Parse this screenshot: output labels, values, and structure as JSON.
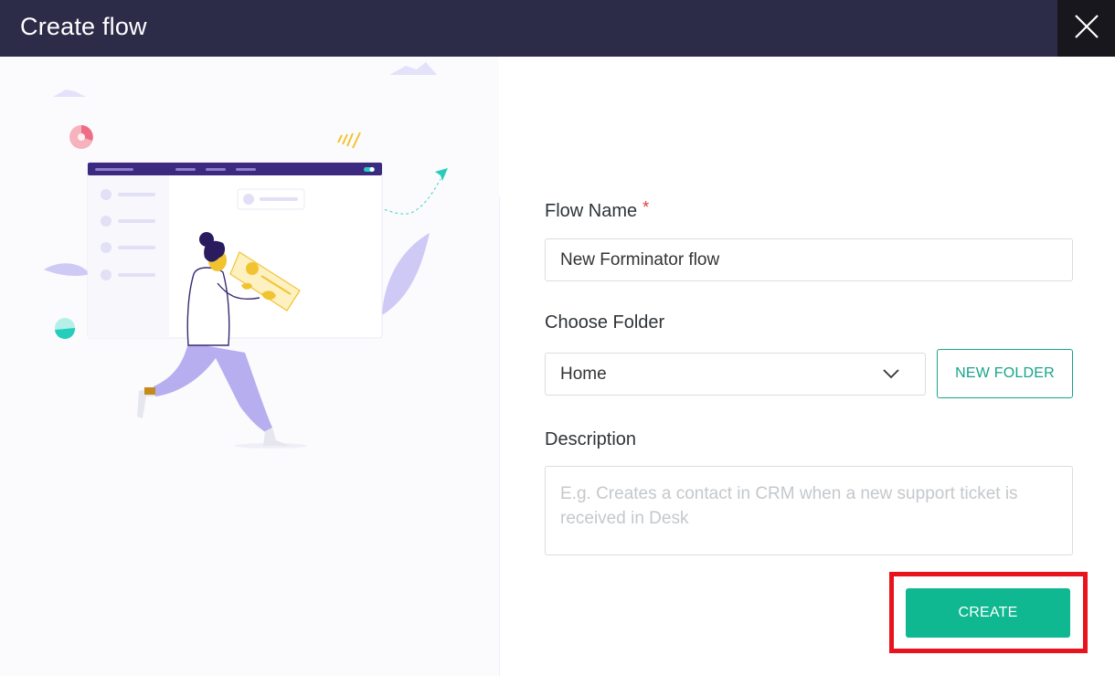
{
  "header": {
    "title": "Create flow",
    "close_icon": "close-icon"
  },
  "form": {
    "flow_name": {
      "label": "Flow Name",
      "required_mark": "*",
      "value": "New Forminator flow"
    },
    "folder": {
      "label": "Choose Folder",
      "selected": "Home",
      "new_folder_label": "NEW FOLDER"
    },
    "description": {
      "label": "Description",
      "placeholder": "E.g. Creates a contact in CRM when a new support ticket is received in Desk"
    },
    "create_label": "CREATE"
  },
  "colors": {
    "header_bg": "#2c2c49",
    "accent": "#0fb890",
    "highlight": "#e8131c",
    "illustration_purple": "#b7aef0"
  }
}
